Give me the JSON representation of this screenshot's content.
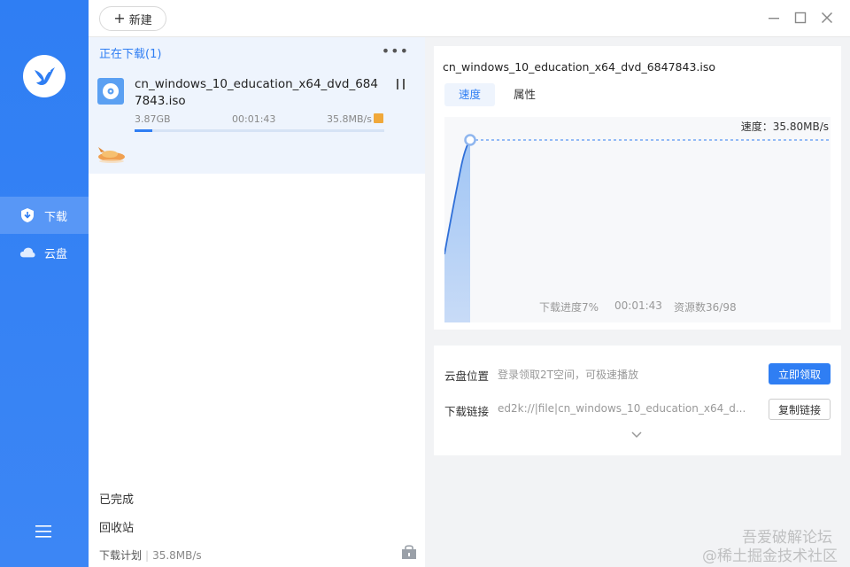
{
  "toolbar": {
    "new_label": "新建"
  },
  "nav": {
    "items": [
      {
        "label": "下载",
        "icon": "download-shield-icon"
      },
      {
        "label": "云盘",
        "icon": "cloud-icon"
      }
    ]
  },
  "list": {
    "downloading_title": "正在下载(1)",
    "task": {
      "name": "cn_windows_10_education_x64_dvd_6847843.iso",
      "size": "3.87GB",
      "elapsed": "00:01:43",
      "speed": "35.8MB/s",
      "progress": 0.07
    },
    "completed": "已完成",
    "recycle": "回收站",
    "plan_label": "下载计划",
    "plan_speed": "35.8MB/s"
  },
  "detail": {
    "filename": "cn_windows_10_education_x64_dvd_6847843.iso",
    "tabs": [
      {
        "label": "速度"
      },
      {
        "label": "属性"
      }
    ],
    "speed_label": "速度：35.80MB/s",
    "progress_text": "下载进度7%",
    "elapsed": "00:01:43",
    "sources": "资源数36/98"
  },
  "cloud": {
    "location_label": "云盘位置",
    "location_text": "登录领取2T空间，可极速播放",
    "claim_button": "立即领取",
    "link_label": "下载链接",
    "link_text": "ed2k://|file|cn_windows_10_education_x64_d...",
    "copy_button": "复制链接"
  },
  "watermarks": [
    "吾爱破解论坛",
    "@稀土掘金技术社区"
  ],
  "colors": {
    "accent": "#2f7ef3",
    "turbo": "#f0a83a"
  }
}
